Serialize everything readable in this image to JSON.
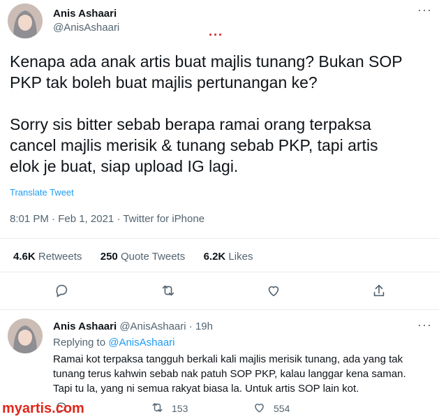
{
  "main_tweet": {
    "author_name": "Anis Ashaari",
    "author_handle": "@AnisAshaari",
    "text": "Kenapa ada anak artis buat majlis tunang? Bukan SOP\nPKP tak boleh buat majlis pertunangan ke?\n\nSorry sis bitter sebab berapa ramai orang terpaksa\ncancel majlis merisik & tunang sebab PKP, tapi artis\nelok je buat, siap upload IG lagi.",
    "translate_label": "Translate Tweet",
    "timestamp": "8:01 PM · Feb 1, 2021 · Twitter for iPhone",
    "stats": {
      "retweets_count": "4.6K",
      "retweets_label": "Retweets",
      "quotes_count": "250",
      "quotes_label": "Quote Tweets",
      "likes_count": "6.2K",
      "likes_label": "Likes"
    }
  },
  "reply": {
    "author_name": "Anis Ashaari",
    "author_handle": "@AnisAshaari",
    "time": "19h",
    "replying_prefix": "Replying to",
    "replying_to": "@AnisAshaari",
    "text": "Ramai kot terpaksa tangguh berkali kali majlis merisik tunang, ada yang tak\ntunang terus kahwin sebab nak patuh SOP PKP, kalau langgar kena saman.\nTapi tu la, yang ni semua rakyat biasa la. Untuk artis SOP lain kot.",
    "retweet_count": "153",
    "like_count": "554"
  },
  "watermark": "myartis.com",
  "icons": [
    "reply-icon",
    "retweet-icon",
    "like-icon",
    "share-icon",
    "more-icon"
  ],
  "colors": {
    "link": "#1d9bf0",
    "secondary": "#536471",
    "watermark": "#e0261b"
  }
}
